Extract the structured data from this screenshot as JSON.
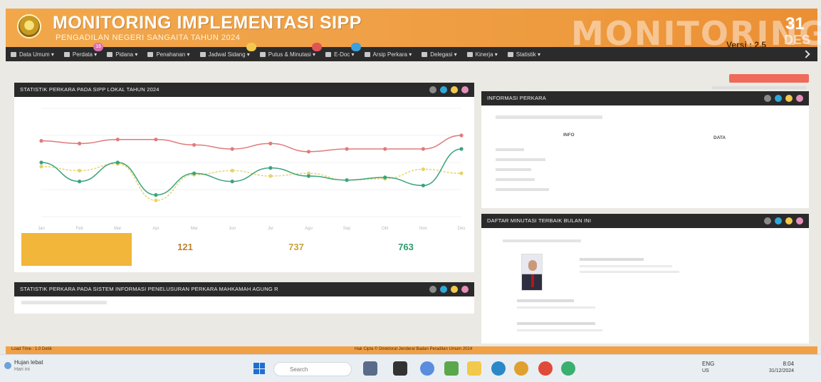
{
  "header": {
    "title": "MONITORING IMPLEMENTASI SIPP",
    "subtitle": "PENGADILAN NEGERI SANGAITA TAHUN 2024",
    "big_word": "MONITORING",
    "version": "Versi : 2.5",
    "date_day": "31",
    "date_month": "DES"
  },
  "nav": {
    "items": [
      {
        "label": "Data Umum ▾",
        "icon": "home-icon"
      },
      {
        "label": "Perdata ▾",
        "icon": "briefcase-icon",
        "badge": "16",
        "badge_color": "#d86fb0"
      },
      {
        "label": "Pidana ▾",
        "icon": "gavel-icon"
      },
      {
        "label": "Penahanan ▾",
        "icon": "lock-icon"
      },
      {
        "label": "Jadwal Sidang ▾",
        "icon": "calendar-icon",
        "badge": "",
        "badge_color": "#f2c94c"
      },
      {
        "label": "Putus & Minutasi ▾",
        "icon": "document-icon",
        "badge": "",
        "badge_color": "#e25454"
      },
      {
        "label": "E-Doc ▾",
        "icon": "folder-icon",
        "badge": "",
        "badge_color": "#3aa0e0"
      },
      {
        "label": "Arsip Perkara ▾",
        "icon": "archive-icon"
      },
      {
        "label": "Delegasi ▾",
        "icon": "share-icon"
      },
      {
        "label": "Kinerja ▾",
        "icon": "bar-chart-icon"
      },
      {
        "label": "Statistik ▾",
        "icon": "stats-icon"
      }
    ]
  },
  "panels": {
    "stats_local": {
      "title": "STATISTIK PERKARA PADA SIPP LOKAL TAHUN 2024"
    },
    "stats_mahkamah": {
      "title": "STATISTIK PERKARA PADA SISTEM INFORMASI PENELUSURAN PERKARA MAHKAMAH AGUNG R"
    },
    "info_perkara": {
      "title": "INFORMASI PERKARA",
      "col_info": "INFO",
      "col_data": "DATA"
    },
    "minutasi": {
      "title": "DAFTAR MINUTASI TERBAIK BULAN INI"
    }
  },
  "dot_colors": [
    "#8a8a8a",
    "#2fa8d8",
    "#f2c94c",
    "#e58fb8"
  ],
  "summary": [
    {
      "label": "",
      "value": "",
      "color": "#f2b63a"
    },
    {
      "label": "",
      "value": "121",
      "color": "#c0822c"
    },
    {
      "label": "",
      "value": "737",
      "color": "#c9a23a"
    },
    {
      "label": "",
      "value": "763",
      "color": "#2e9a6e"
    }
  ],
  "chart_data": {
    "type": "line",
    "x": [
      "Jan",
      "Feb",
      "Mar",
      "Apr",
      "Mei",
      "Jun",
      "Jul",
      "Agu",
      "Sep",
      "Okt",
      "Nov",
      "Des"
    ],
    "ylim": [
      0,
      4
    ],
    "series": [
      {
        "color": "#e07a7a",
        "values": [
          2.8,
          2.7,
          2.85,
          2.85,
          2.65,
          2.5,
          2.7,
          2.4,
          2.5,
          2.5,
          2.5,
          3.0
        ]
      },
      {
        "color": "#e8d36a",
        "values": [
          1.85,
          1.7,
          1.95,
          0.6,
          1.55,
          1.7,
          1.5,
          1.6,
          1.35,
          1.4,
          1.75,
          1.6
        ]
      },
      {
        "color": "#3aa37a",
        "values": [
          2.0,
          1.3,
          2.0,
          0.8,
          1.6,
          1.3,
          1.8,
          1.5,
          1.35,
          1.45,
          1.15,
          2.5
        ]
      }
    ]
  },
  "footer": {
    "left": "Load Time : 1.0 Detik",
    "center": "Hak Cipta © Direktorat Jenderal Badan Peradilan Umum 2024"
  },
  "taskbar": {
    "weather": "Hujan lebat",
    "weather_sub": "Hari ini",
    "search": "Search",
    "lang": "ENG",
    "region": "US",
    "time": "8:04",
    "date": "31/12/2024"
  }
}
